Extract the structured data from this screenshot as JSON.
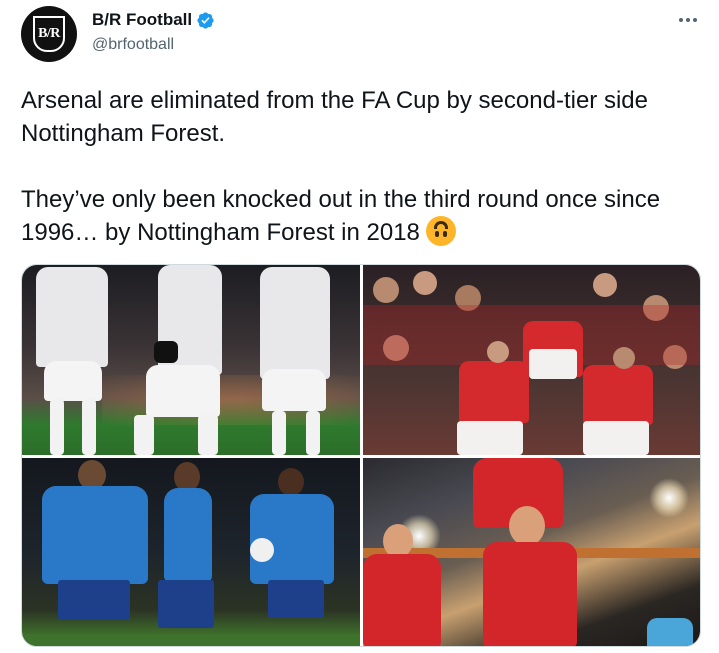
{
  "account": {
    "display_name": "B/R Football",
    "handle": "@brfootball",
    "avatar_text": "B/R",
    "verified": true,
    "verified_color": "#1d9bf0"
  },
  "tweet": {
    "paragraph1": "Arsenal are eliminated from the FA Cup by second-tier side Nottingham Forest.",
    "paragraph2": "They’ve only been knocked out in the third round once since 1996… by Nottingham Forest in 2018",
    "emoji": "upside-down-face-icon"
  },
  "media": {
    "photos": [
      {
        "name": "arsenal-players-white-kit-photo"
      },
      {
        "name": "forest-crowd-celebration-photo"
      },
      {
        "name": "arsenal-players-blue-kit-photo"
      },
      {
        "name": "forest-players-celebration-photo"
      }
    ]
  },
  "icons": {
    "more": "more-options-icon",
    "verified": "verified-badge-icon"
  },
  "colors": {
    "text": "#0f1419",
    "secondary_text": "#536471",
    "border": "#cfd9de"
  }
}
